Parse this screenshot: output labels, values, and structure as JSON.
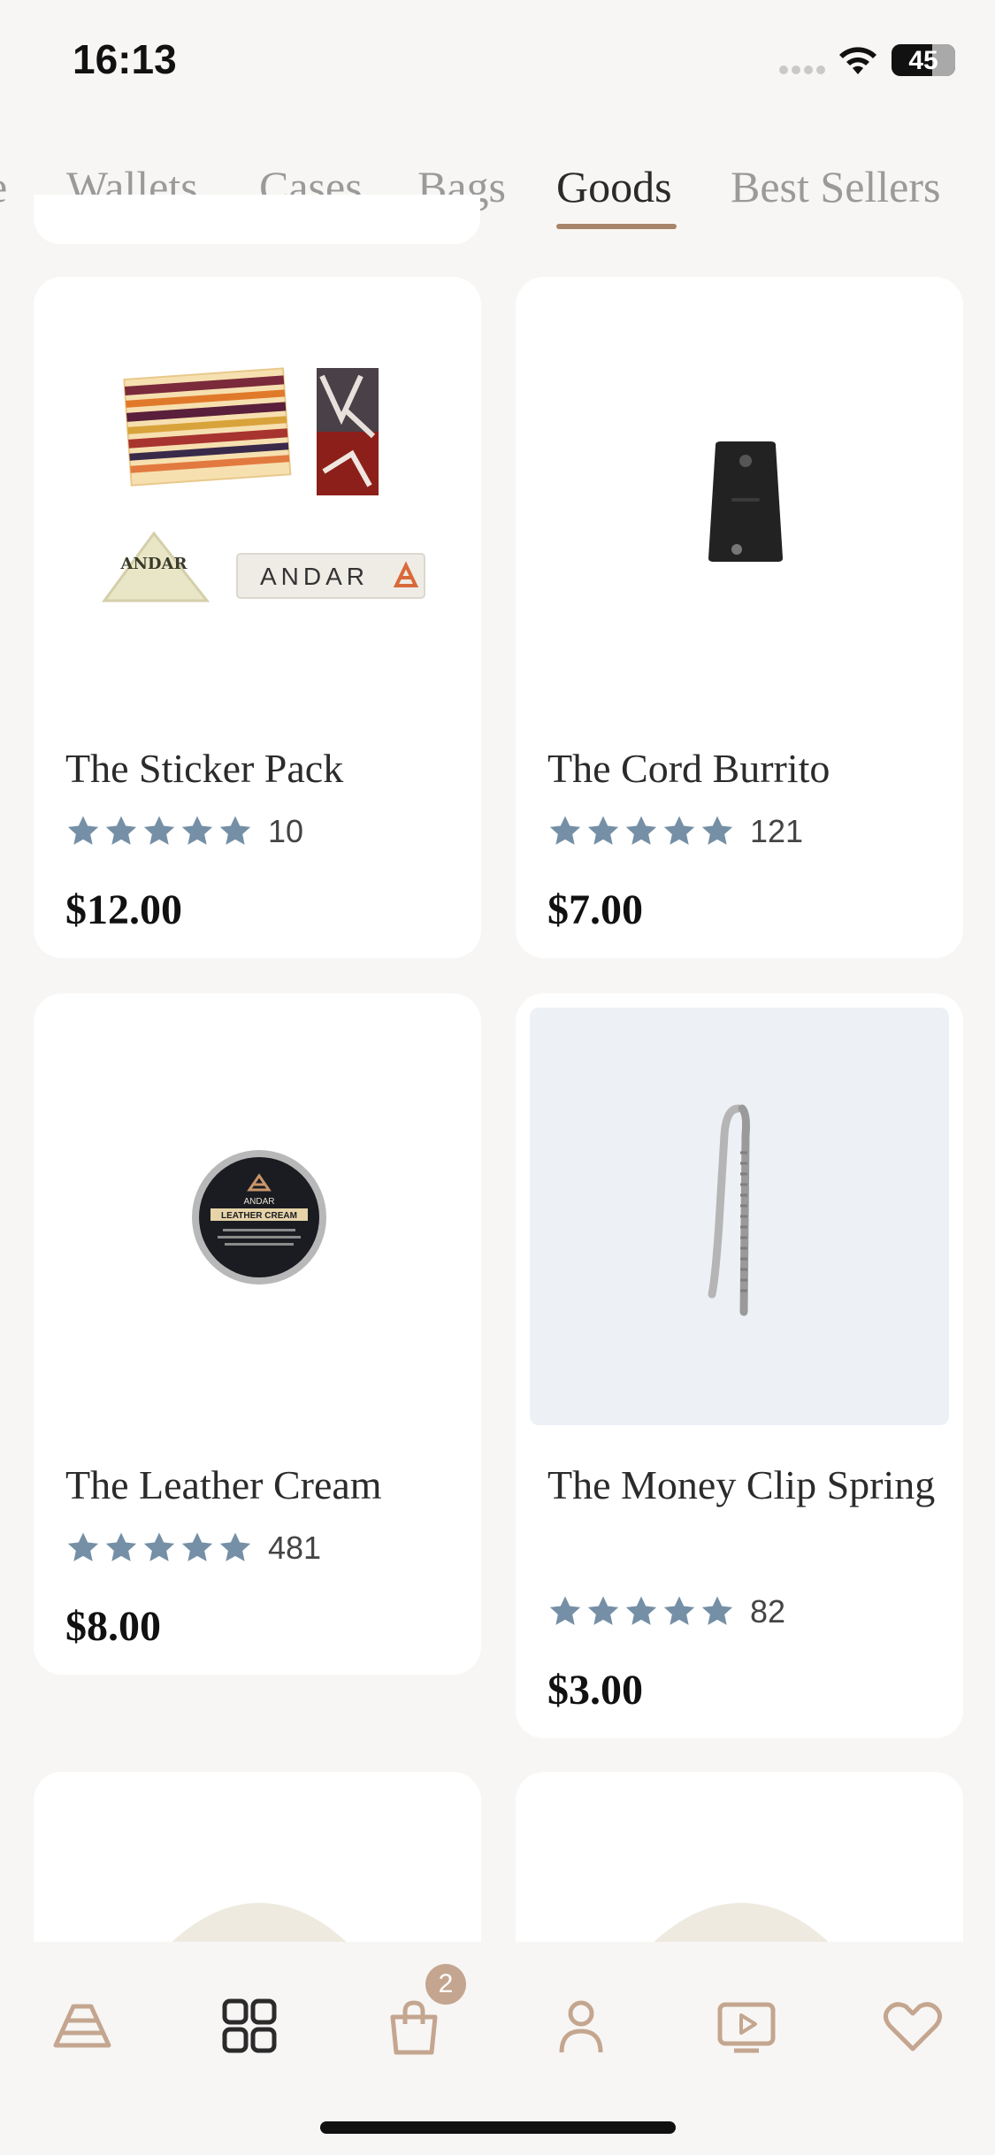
{
  "status_bar": {
    "time": "16:13",
    "battery_level": "45"
  },
  "tabs": [
    {
      "label": "e"
    },
    {
      "label": "Wallets"
    },
    {
      "label": "Cases"
    },
    {
      "label": "Bags"
    },
    {
      "label": "Goods",
      "active": true
    },
    {
      "label": "Best Sellers"
    }
  ],
  "products": [
    {
      "name": "The Sticker Pack",
      "rating": 5,
      "reviews": "10",
      "price": "$12.00",
      "brand_text": "ANDAR"
    },
    {
      "name": "The Cord Burrito",
      "rating": 5,
      "reviews": "121",
      "price": "$7.00"
    },
    {
      "name": "The Leather Cream",
      "rating": 5,
      "reviews": "481",
      "price": "$8.00",
      "label_text": "LEATHER CREAM",
      "brand_text": "ANDAR"
    },
    {
      "name": "The Money Clip Spring",
      "rating": 5,
      "reviews": "82",
      "price": "$3.00"
    }
  ],
  "bottom_nav": {
    "items": [
      "home-icon",
      "grid-icon",
      "bag-icon",
      "profile-icon",
      "video-icon",
      "heart-icon"
    ],
    "cart_count": "2"
  },
  "colors": {
    "accent": "#a8856a",
    "star": "#7590a6",
    "background": "#f8f6f4"
  }
}
